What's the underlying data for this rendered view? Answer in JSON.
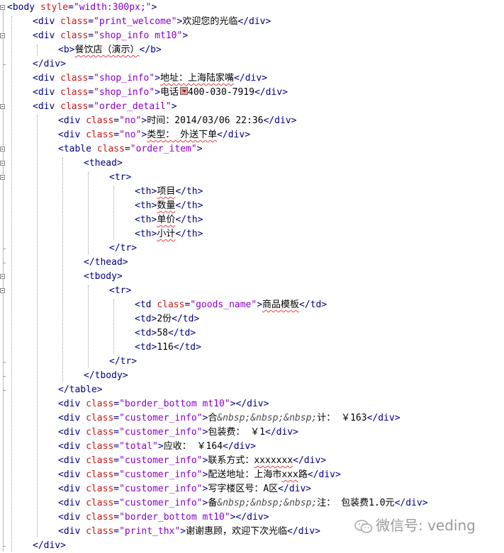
{
  "lines": [
    {
      "indent": 0,
      "parts": [
        {
          "t": "tag",
          "v": "<body "
        },
        {
          "t": "attr",
          "v": "style"
        },
        {
          "t": "tag",
          "v": "="
        },
        {
          "t": "val",
          "v": "\"width:300px;\""
        },
        {
          "t": "tag",
          "v": ">"
        }
      ]
    },
    {
      "indent": 1,
      "parts": [
        {
          "t": "tag",
          "v": "<div "
        },
        {
          "t": "attr",
          "v": "class"
        },
        {
          "t": "tag",
          "v": "="
        },
        {
          "t": "val",
          "v": "\"print_welcome\""
        },
        {
          "t": "tag",
          "v": ">"
        },
        {
          "t": "txt",
          "v": "欢迎您的光临"
        },
        {
          "t": "tag",
          "v": "</div>"
        }
      ]
    },
    {
      "indent": 1,
      "parts": [
        {
          "t": "tag",
          "v": "<div "
        },
        {
          "t": "attr",
          "v": "class"
        },
        {
          "t": "tag",
          "v": "="
        },
        {
          "t": "val",
          "v": "\"shop_info mt10\""
        },
        {
          "t": "tag",
          "v": ">"
        }
      ]
    },
    {
      "indent": 2,
      "parts": [
        {
          "t": "tag",
          "v": "<b>"
        },
        {
          "t": "txt",
          "v": "餐饮店（演示）",
          "sq": true
        },
        {
          "t": "tag",
          "v": "</b>"
        }
      ]
    },
    {
      "indent": 1,
      "parts": [
        {
          "t": "tag",
          "v": "</div>"
        }
      ]
    },
    {
      "indent": 1,
      "parts": [
        {
          "t": "tag",
          "v": "<div "
        },
        {
          "t": "attr",
          "v": "class"
        },
        {
          "t": "tag",
          "v": "="
        },
        {
          "t": "val",
          "v": "\"shop_info\""
        },
        {
          "t": "tag",
          "v": ">"
        },
        {
          "t": "txt",
          "v": "地址：上海陆家嘴",
          "sq": true
        },
        {
          "t": "tag",
          "v": "</div>"
        }
      ]
    },
    {
      "indent": 1,
      "parts": [
        {
          "t": "tag",
          "v": "<div "
        },
        {
          "t": "attr",
          "v": "class"
        },
        {
          "t": "tag",
          "v": "="
        },
        {
          "t": "val",
          "v": "\"shop_info\""
        },
        {
          "t": "tag",
          "v": ">"
        },
        {
          "t": "txt",
          "v": "电话：400-030-7919"
        },
        {
          "t": "tag",
          "v": "</div>"
        }
      ]
    },
    {
      "indent": 1,
      "parts": [
        {
          "t": "tag",
          "v": "<div "
        },
        {
          "t": "attr",
          "v": "class"
        },
        {
          "t": "tag",
          "v": "="
        },
        {
          "t": "val",
          "v": "\"order_detail\""
        },
        {
          "t": "tag",
          "v": ">"
        }
      ]
    },
    {
      "indent": 2,
      "parts": [
        {
          "t": "tag",
          "v": "<div "
        },
        {
          "t": "attr",
          "v": "class"
        },
        {
          "t": "tag",
          "v": "="
        },
        {
          "t": "val",
          "v": "\"no\""
        },
        {
          "t": "tag",
          "v": ">"
        },
        {
          "t": "txt",
          "v": "时间：2014/03/06 22:36"
        },
        {
          "t": "tag",
          "v": "</div>"
        }
      ]
    },
    {
      "indent": 2,
      "parts": [
        {
          "t": "tag",
          "v": "<div "
        },
        {
          "t": "attr",
          "v": "class"
        },
        {
          "t": "tag",
          "v": "="
        },
        {
          "t": "val",
          "v": "\"no\""
        },
        {
          "t": "tag",
          "v": ">"
        },
        {
          "t": "txt",
          "v": "类型： 外送下单",
          "sq": true
        },
        {
          "t": "tag",
          "v": "</div>"
        }
      ]
    },
    {
      "indent": 2,
      "parts": [
        {
          "t": "tag",
          "v": "<table "
        },
        {
          "t": "attr",
          "v": "class"
        },
        {
          "t": "tag",
          "v": "="
        },
        {
          "t": "val",
          "v": "\"order_item\""
        },
        {
          "t": "tag",
          "v": ">"
        }
      ]
    },
    {
      "indent": 3,
      "parts": [
        {
          "t": "tag",
          "v": "<thead>"
        }
      ]
    },
    {
      "indent": 4,
      "parts": [
        {
          "t": "tag",
          "v": "<tr>"
        }
      ]
    },
    {
      "indent": 5,
      "parts": [
        {
          "t": "tag",
          "v": "<th>"
        },
        {
          "t": "txt",
          "v": "项目",
          "sq": true
        },
        {
          "t": "tag",
          "v": "</th>"
        }
      ]
    },
    {
      "indent": 5,
      "parts": [
        {
          "t": "tag",
          "v": "<th>"
        },
        {
          "t": "txt",
          "v": "数量",
          "sq": true
        },
        {
          "t": "tag",
          "v": "</th>"
        }
      ]
    },
    {
      "indent": 5,
      "parts": [
        {
          "t": "tag",
          "v": "<th>"
        },
        {
          "t": "txt",
          "v": "单价",
          "sq": true
        },
        {
          "t": "tag",
          "v": "</th>"
        }
      ]
    },
    {
      "indent": 5,
      "parts": [
        {
          "t": "tag",
          "v": "<th>"
        },
        {
          "t": "txt",
          "v": "小计",
          "sq": true
        },
        {
          "t": "tag",
          "v": "</th>"
        }
      ]
    },
    {
      "indent": 4,
      "parts": [
        {
          "t": "tag",
          "v": "</tr>"
        }
      ]
    },
    {
      "indent": 3,
      "parts": [
        {
          "t": "tag",
          "v": "</thead>"
        }
      ]
    },
    {
      "indent": 3,
      "parts": [
        {
          "t": "tag",
          "v": "<tbody>"
        }
      ]
    },
    {
      "indent": 4,
      "parts": [
        {
          "t": "tag",
          "v": "<tr>"
        }
      ]
    },
    {
      "indent": 5,
      "parts": [
        {
          "t": "tag",
          "v": "<td "
        },
        {
          "t": "attr",
          "v": "class"
        },
        {
          "t": "tag",
          "v": "="
        },
        {
          "t": "val",
          "v": "\"goods_name\""
        },
        {
          "t": "tag",
          "v": ">"
        },
        {
          "t": "txt",
          "v": "商品模板",
          "sq": true
        },
        {
          "t": "tag",
          "v": "</td>"
        }
      ]
    },
    {
      "indent": 5,
      "parts": [
        {
          "t": "tag",
          "v": "<td>"
        },
        {
          "t": "txt",
          "v": "2份"
        },
        {
          "t": "tag",
          "v": "</td>"
        }
      ]
    },
    {
      "indent": 5,
      "parts": [
        {
          "t": "tag",
          "v": "<td>"
        },
        {
          "t": "txt",
          "v": "58"
        },
        {
          "t": "tag",
          "v": "</td>"
        }
      ]
    },
    {
      "indent": 5,
      "parts": [
        {
          "t": "tag",
          "v": "<td>"
        },
        {
          "t": "txt",
          "v": "116"
        },
        {
          "t": "tag",
          "v": "</td>"
        }
      ]
    },
    {
      "indent": 4,
      "parts": [
        {
          "t": "tag",
          "v": "</tr>"
        }
      ]
    },
    {
      "indent": 3,
      "parts": [
        {
          "t": "tag",
          "v": "</tbody>"
        }
      ]
    },
    {
      "indent": 2,
      "parts": [
        {
          "t": "tag",
          "v": "</table>"
        }
      ]
    },
    {
      "indent": 2,
      "parts": [
        {
          "t": "tag",
          "v": "<div "
        },
        {
          "t": "attr",
          "v": "class"
        },
        {
          "t": "tag",
          "v": "="
        },
        {
          "t": "val",
          "v": "\"border_bottom mt10\""
        },
        {
          "t": "tag",
          "v": "></div>"
        }
      ]
    },
    {
      "indent": 2,
      "parts": [
        {
          "t": "tag",
          "v": "<div "
        },
        {
          "t": "attr",
          "v": "class"
        },
        {
          "t": "tag",
          "v": "="
        },
        {
          "t": "val",
          "v": "\"customer_info\""
        },
        {
          "t": "tag",
          "v": ">"
        },
        {
          "t": "txt",
          "v": "合"
        },
        {
          "t": "ent",
          "v": "&nbsp;&nbsp;&nbsp;"
        },
        {
          "t": "txt",
          "v": "计： ￥163"
        },
        {
          "t": "tag",
          "v": "</div>"
        }
      ]
    },
    {
      "indent": 2,
      "parts": [
        {
          "t": "tag",
          "v": "<div "
        },
        {
          "t": "attr",
          "v": "class"
        },
        {
          "t": "tag",
          "v": "="
        },
        {
          "t": "val",
          "v": "\"customer_info\""
        },
        {
          "t": "tag",
          "v": ">"
        },
        {
          "t": "txt",
          "v": "包装费： ￥1"
        },
        {
          "t": "tag",
          "v": "</div>"
        }
      ]
    },
    {
      "indent": 2,
      "parts": [
        {
          "t": "tag",
          "v": "<div "
        },
        {
          "t": "attr",
          "v": "class"
        },
        {
          "t": "tag",
          "v": "="
        },
        {
          "t": "val",
          "v": "\"total\""
        },
        {
          "t": "tag",
          "v": ">"
        },
        {
          "t": "txt",
          "v": "应收： ￥164"
        },
        {
          "t": "tag",
          "v": "</div>"
        }
      ]
    },
    {
      "indent": 2,
      "parts": [
        {
          "t": "tag",
          "v": "<div "
        },
        {
          "t": "attr",
          "v": "class"
        },
        {
          "t": "tag",
          "v": "="
        },
        {
          "t": "val",
          "v": "\"customer_info\""
        },
        {
          "t": "tag",
          "v": ">"
        },
        {
          "t": "txt",
          "v": "联系方式："
        },
        {
          "t": "txt",
          "v": "xxxxxxx",
          "sq": true
        },
        {
          "t": "tag",
          "v": "</div>"
        }
      ]
    },
    {
      "indent": 2,
      "parts": [
        {
          "t": "tag",
          "v": "<div "
        },
        {
          "t": "attr",
          "v": "class"
        },
        {
          "t": "tag",
          "v": "="
        },
        {
          "t": "val",
          "v": "\"customer_info\""
        },
        {
          "t": "tag",
          "v": ">"
        },
        {
          "t": "txt",
          "v": "配送地址：上海市"
        },
        {
          "t": "txt",
          "v": "xxx",
          "sq": true
        },
        {
          "t": "txt",
          "v": "路"
        },
        {
          "t": "tag",
          "v": "</div>"
        }
      ]
    },
    {
      "indent": 2,
      "parts": [
        {
          "t": "tag",
          "v": "<div "
        },
        {
          "t": "attr",
          "v": "class"
        },
        {
          "t": "tag",
          "v": "="
        },
        {
          "t": "val",
          "v": "\"customer_info\""
        },
        {
          "t": "tag",
          "v": ">"
        },
        {
          "t": "txt",
          "v": "写字楼区号：A区"
        },
        {
          "t": "tag",
          "v": "</div>"
        }
      ]
    },
    {
      "indent": 2,
      "parts": [
        {
          "t": "tag",
          "v": "<div "
        },
        {
          "t": "attr",
          "v": "class"
        },
        {
          "t": "tag",
          "v": "="
        },
        {
          "t": "val",
          "v": "\"customer_info\""
        },
        {
          "t": "tag",
          "v": ">"
        },
        {
          "t": "txt",
          "v": "备"
        },
        {
          "t": "ent",
          "v": "&nbsp;&nbsp;&nbsp;"
        },
        {
          "t": "txt",
          "v": "注： 包装费1.0元"
        },
        {
          "t": "tag",
          "v": "</div>"
        }
      ]
    },
    {
      "indent": 2,
      "parts": [
        {
          "t": "tag",
          "v": "<div "
        },
        {
          "t": "attr",
          "v": "class"
        },
        {
          "t": "tag",
          "v": "="
        },
        {
          "t": "val",
          "v": "\"border_bottom mt10\""
        },
        {
          "t": "tag",
          "v": "></div>"
        }
      ]
    },
    {
      "indent": 2,
      "parts": [
        {
          "t": "tag",
          "v": "<div "
        },
        {
          "t": "attr",
          "v": "class"
        },
        {
          "t": "tag",
          "v": "="
        },
        {
          "t": "val",
          "v": "\"print_thx\""
        },
        {
          "t": "tag",
          "v": ">"
        },
        {
          "t": "txt",
          "v": "谢谢惠顾，欢迎下次光临"
        },
        {
          "t": "tag",
          "v": "</div>"
        }
      ]
    },
    {
      "indent": 1,
      "parts": [
        {
          "t": "tag",
          "v": "</div>"
        }
      ]
    }
  ],
  "watermark": {
    "text": "微信号: veding",
    "icon": "wechat-icon"
  },
  "colors": {
    "tag": "#000080",
    "attr": "#c81818",
    "val": "#8a00c8",
    "text": "#000000"
  }
}
